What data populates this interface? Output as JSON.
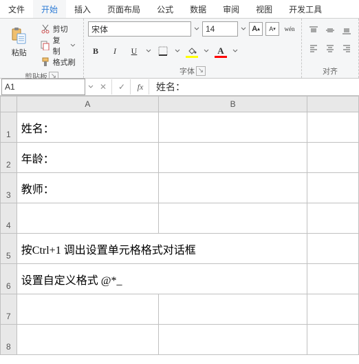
{
  "menu": {
    "file": "文件",
    "home": "开始",
    "insert": "插入",
    "layout": "页面布局",
    "formula": "公式",
    "data": "数据",
    "review": "审阅",
    "view": "视图",
    "dev": "开发工具"
  },
  "clipboard": {
    "paste": "粘贴",
    "cut": "剪切",
    "copy": "复制",
    "fmtpainter": "格式刷",
    "title": "剪贴板"
  },
  "font": {
    "name": "宋体",
    "size": "14",
    "title": "字体",
    "incA": "A",
    "decA": "A",
    "wen": "wén",
    "bold": "B",
    "italic": "I",
    "underline": "U"
  },
  "align": {
    "title": "对齐"
  },
  "namebox": "A1",
  "formula_value": "姓名：",
  "cols": {
    "A": "A",
    "B": "B"
  },
  "cells": {
    "A1": "姓名：",
    "A2": "年龄：",
    "A3": "教师：",
    "A4": "",
    "A5": "按Ctrl+1 调出设置单元格格式对话框",
    "A6": "设置自定义格式 @*_",
    "A7": "",
    "A8": ""
  },
  "chart_data": null
}
